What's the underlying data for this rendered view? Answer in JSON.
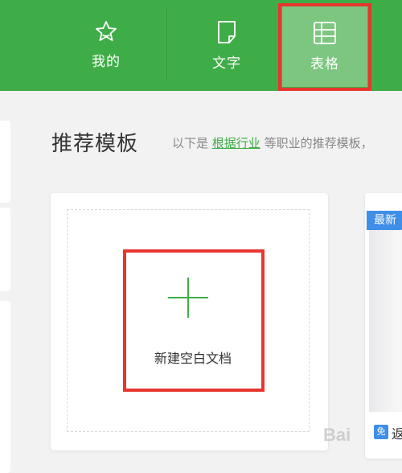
{
  "nav": {
    "items": [
      {
        "label": "我的",
        "icon": "star-icon"
      },
      {
        "label": "文字",
        "icon": "document-icon"
      },
      {
        "label": "表格",
        "icon": "table-icon"
      }
    ]
  },
  "section": {
    "title": "推荐模板",
    "desc_prefix": "以下是 ",
    "desc_link": "根据行业",
    "desc_suffix": " 等职业的推荐模板，"
  },
  "blank_card": {
    "label": "新建空白文档"
  },
  "template_card": {
    "badge": "最新",
    "free_badge": "免",
    "title_fragment": "返"
  },
  "watermark": "Bai"
}
